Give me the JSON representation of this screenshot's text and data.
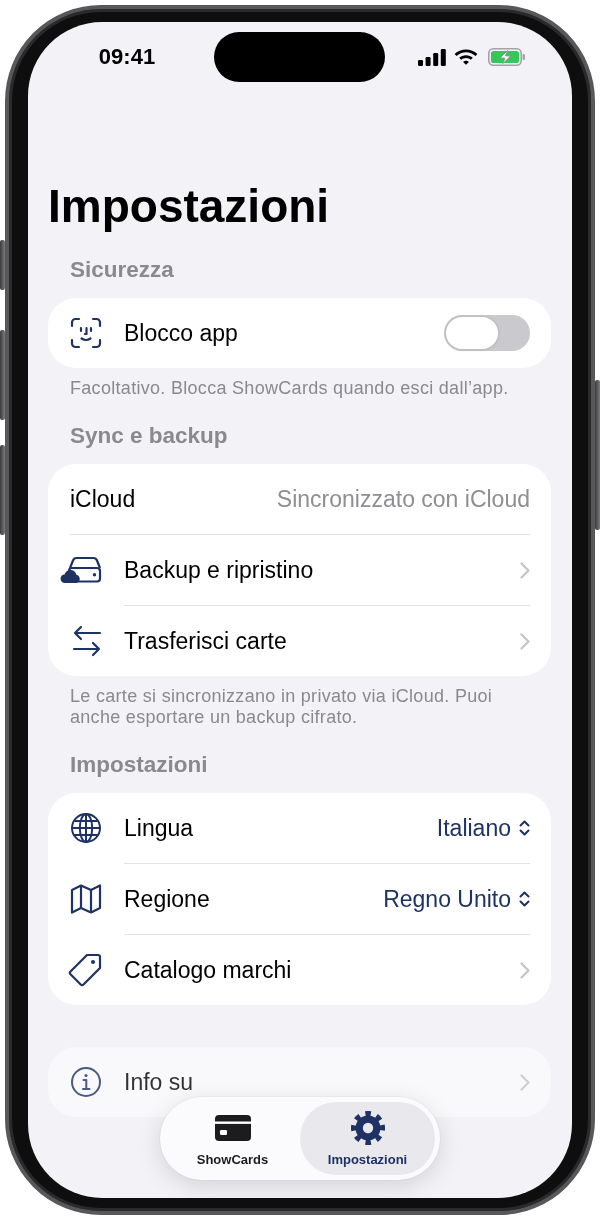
{
  "status_bar": {
    "time": "09:41"
  },
  "title": "Impostazioni",
  "sections": [
    {
      "header": "Sicurezza",
      "rows": [
        {
          "kind": "toggle",
          "label": "Blocco app",
          "on": false
        }
      ],
      "footer": "Facoltativo. Blocca ShowCards quando esci dall’app."
    },
    {
      "header": "Sync e backup",
      "rows": [
        {
          "kind": "detail",
          "label": "iCloud",
          "value": "Sincronizzato con iCloud"
        },
        {
          "kind": "link",
          "label": "Backup e ripristino"
        },
        {
          "kind": "link",
          "label": "Trasferisci carte"
        }
      ],
      "footer": "Le carte si sincronizzano in privato via iCloud. Puoi anche esportare un backup cifrato."
    },
    {
      "header": "Impostazioni",
      "rows": [
        {
          "kind": "picker",
          "label": "Lingua",
          "value": "Italiano"
        },
        {
          "kind": "picker",
          "label": "Regione",
          "value": "Regno Unito"
        },
        {
          "kind": "link",
          "label": "Catalogo marchi"
        }
      ]
    },
    {
      "rows": [
        {
          "kind": "link",
          "label": "Info su"
        }
      ]
    }
  ],
  "tab_bar": {
    "tabs": [
      {
        "label": "ShowCards",
        "selected": false
      },
      {
        "label": "Impostazioni",
        "selected": true
      }
    ]
  }
}
